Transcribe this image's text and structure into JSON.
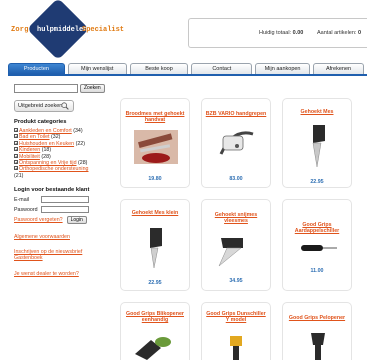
{
  "header": {
    "logo_left": "Zorg",
    "logo_mid": "hulpmiddelen",
    "logo_right": "Specialist",
    "cart_total_label": "Huidig totaal:",
    "cart_total_value": "0.00",
    "cart_items_label": "Aantal artikelen:",
    "cart_items_value": "0"
  },
  "nav": {
    "tabs": [
      {
        "label": "Producten",
        "active": true
      },
      {
        "label": "Mijn wenslijst"
      },
      {
        "label": "Beste koop"
      },
      {
        "label": "Contact"
      },
      {
        "label": "Mijn aankopen"
      },
      {
        "label": "Afrekenen"
      }
    ]
  },
  "sidebar": {
    "search_placeholder": "",
    "search_button": "Zoeken",
    "advanced_search": "Uitgebreid zoeken",
    "categories_title": "Produkt categories",
    "categories": [
      {
        "name": "Aankleden en Comfort",
        "count": "(34)"
      },
      {
        "name": "Bad en Toilet",
        "count": "(32)"
      },
      {
        "name": "Huishouden en Keuken",
        "count": "(22)"
      },
      {
        "name": "Kinderen",
        "count": "(18)"
      },
      {
        "name": "Mobiliteit",
        "count": "(28)"
      },
      {
        "name": "Ontspanning en Vrije tijd",
        "count": "(28)"
      },
      {
        "name": "Orthopedische ondersteuning",
        "count": "(21)"
      }
    ],
    "login_title": "Login voor bestaande klant",
    "email_label": "E-mail",
    "password_label": "Paswoord",
    "forgot_link": "Paswoord vergeten?",
    "login_button": "Login",
    "links": [
      "Algemene voorwaarden",
      "Inschrijven op de nieuwsbrief",
      "Gastenboek",
      "Je wenst dealer te worden?"
    ]
  },
  "products": [
    {
      "title": "Broodmes met gehoekt handvat",
      "price": "19.80"
    },
    {
      "title": "BZB VARIO handgrepen",
      "price": "83.00"
    },
    {
      "title": "Gehoekt Mes",
      "price": "22.95"
    },
    {
      "title": "Gehoekt Mes klein",
      "price": "22.95"
    },
    {
      "title": "Gehoekt snijmes vleesmes",
      "price": "34.95"
    },
    {
      "title": "Good Grips Aardappelschiller",
      "price": "11.00"
    },
    {
      "title": "Good Grips Blikopener eenhandig",
      "price": ""
    },
    {
      "title": "Good Grips Dunschiller Y model",
      "price": ""
    },
    {
      "title": "Good Grips Pelopener",
      "price": ""
    }
  ],
  "colors": {
    "brand_blue": "#1f3b73",
    "accent_orange": "#e07a12",
    "link_orange": "#e0531b",
    "tab_blue": "#1f5fae",
    "price_blue": "#2e6fb3"
  }
}
